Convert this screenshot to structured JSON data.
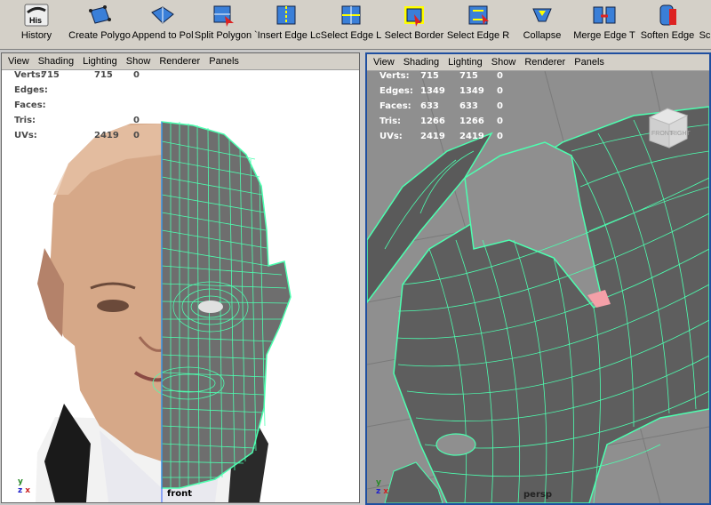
{
  "shelf": {
    "buttons": [
      {
        "name": "history",
        "label": "History",
        "icon": "history-icon",
        "icon_text": "His"
      },
      {
        "name": "create-polygon",
        "label": "Create Polygo",
        "icon": "create-polygon-icon"
      },
      {
        "name": "append-to-polygon",
        "label": "Append to Pol",
        "icon": "append-polygon-icon"
      },
      {
        "name": "split-polygon",
        "label": "Split Polygon",
        "icon": "split-polygon-icon"
      },
      {
        "name": "insert-edge-loop",
        "label": "`Insert Edge Lc",
        "icon": "insert-edge-loop-icon"
      },
      {
        "name": "select-edge-loop",
        "label": "Select Edge L",
        "icon": "select-edge-loop-icon"
      },
      {
        "name": "select-border",
        "label": "Select Border",
        "icon": "select-border-icon"
      },
      {
        "name": "select-edge-ring",
        "label": "Select Edge R",
        "icon": "select-edge-ring-icon"
      },
      {
        "name": "collapse",
        "label": "Collapse",
        "icon": "collapse-icon"
      },
      {
        "name": "merge-edge",
        "label": "Merge Edge T",
        "icon": "merge-edge-icon"
      },
      {
        "name": "soften-edge",
        "label": "Soften Edge",
        "icon": "soften-edge-icon"
      },
      {
        "name": "overflow",
        "label": "Sc",
        "icon": "overflow-icon"
      }
    ]
  },
  "menu": [
    "View",
    "Shading",
    "Lighting",
    "Show",
    "Renderer",
    "Panels"
  ],
  "left_panel": {
    "hud_labels": [
      "Verts:",
      "Edges:",
      "Faces:",
      "Tris:",
      "UVs:"
    ],
    "values": [
      [
        "715",
        "715",
        "0"
      ],
      [
        "",
        "",
        ""
      ],
      [
        "",
        "",
        ""
      ],
      [
        "",
        "",
        "0"
      ],
      [
        "",
        "2419",
        "0"
      ]
    ],
    "camera": "front",
    "axis": {
      "y": "y",
      "z": "z",
      "x": "x"
    }
  },
  "right_panel": {
    "hud_labels": [
      "Verts:",
      "Edges:",
      "Faces:",
      "Tris:",
      "UVs:"
    ],
    "values": [
      [
        "715",
        "715",
        "0"
      ],
      [
        "1349",
        "1349",
        "0"
      ],
      [
        "633",
        "633",
        "0"
      ],
      [
        "1266",
        "1266",
        "0"
      ],
      [
        "2419",
        "2419",
        "0"
      ]
    ],
    "camera": "persp",
    "viewcube": {
      "front": "FRONT",
      "right": "RIGHT"
    },
    "axis": {
      "y": "y",
      "z": "z",
      "x": "x"
    }
  },
  "colors": {
    "wire": "#4dffb0",
    "hud_left": "#4a4a4a",
    "hud_right": "#ffffff",
    "select_face": "#f4a0a8",
    "view_border": "#1f4fa0"
  }
}
